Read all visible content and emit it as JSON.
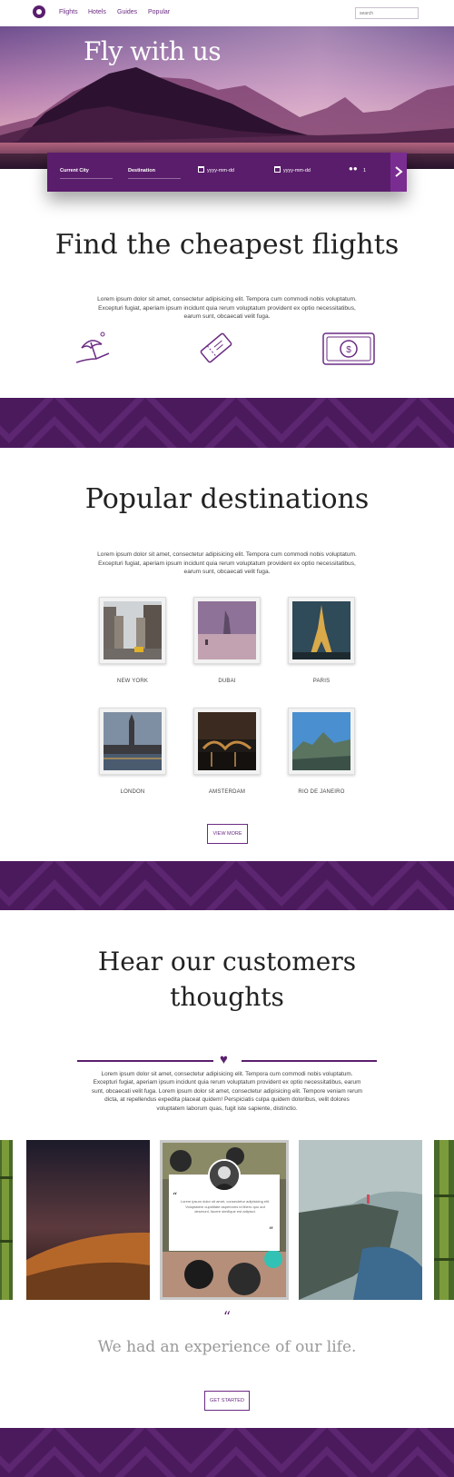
{
  "nav": {
    "links": [
      "Flights",
      "Hotels",
      "Guides",
      "Popular"
    ],
    "search_placeholder": "search"
  },
  "hero": {
    "title": "Fly with us"
  },
  "booking": {
    "current_city": "Current City",
    "destination": "Destination",
    "depart_date": "yyyy-mm-dd",
    "return_date": "yyyy-mm-dd",
    "passengers": "1"
  },
  "cheapest": {
    "heading": "Find the cheapest flights",
    "text": "Lorem ipsum dolor sit amet, consectetur adipisicing elit. Tempora cum commodi nobis voluptatum. Excepturi fugiat, aperiam ipsum incidunt quia rerum voluptatum provident ex optio necessitatibus, earum sunt, obcaecati velit fuga.",
    "icons": [
      "beach-umbrella-icon",
      "ticket-icon",
      "money-icon"
    ]
  },
  "popular": {
    "heading": "Popular destinations",
    "text": "Lorem ipsum dolor sit amet, consectetur adipisicing elit. Tempora cum commodi nobis voluptatum. Excepturi fugiat, aperiam ipsum incidunt quia rerum voluptatum provident ex optio necessitatibus, earum sunt, obcaecati velit fuga.",
    "destinations": [
      "NEW YORK",
      "DUBAI",
      "PARIS",
      "LONDON",
      "AMSTERDAM",
      "RIO DE JANEIRO"
    ],
    "view_more": "VIEW MORE"
  },
  "customers": {
    "heading_line1": "Hear our customers",
    "heading_line2": "thoughts",
    "text": "Lorem ipsum dolor sit amet, consectetur adipisicing elit. Tempora cum commodi nobis voluptatum. Excepturi fugiat, aperiam ipsum incidunt quia rerum voluptatum provident ex optio necessitatibus, earum sunt, obcaecati velit fuga. Lorem ipsum dolor sit amet, consectetur adipisicing elit. Tempore veniam rerum dicta, at repellendus expedita placeat quidem! Perspiciatis culpa quidem doloribus, velit dolores voluptatem laborum quas, fugit iste sapiente, distinctio.",
    "quote_text": "Lorem ipsum dolor sit amet, consectetur adipisicing elit. Voluptatem cupiditate asperiores id libero quo aut deserunt, facere similique est adipisci.",
    "open_quote": "“",
    "close_quote": "”",
    "big_quote": "“",
    "tagline": "We had an experience of our life.",
    "cta": "GET STARTED"
  },
  "colors": {
    "brand_purple": "#5b1e6e",
    "band_purple": "#4b1a5d"
  }
}
